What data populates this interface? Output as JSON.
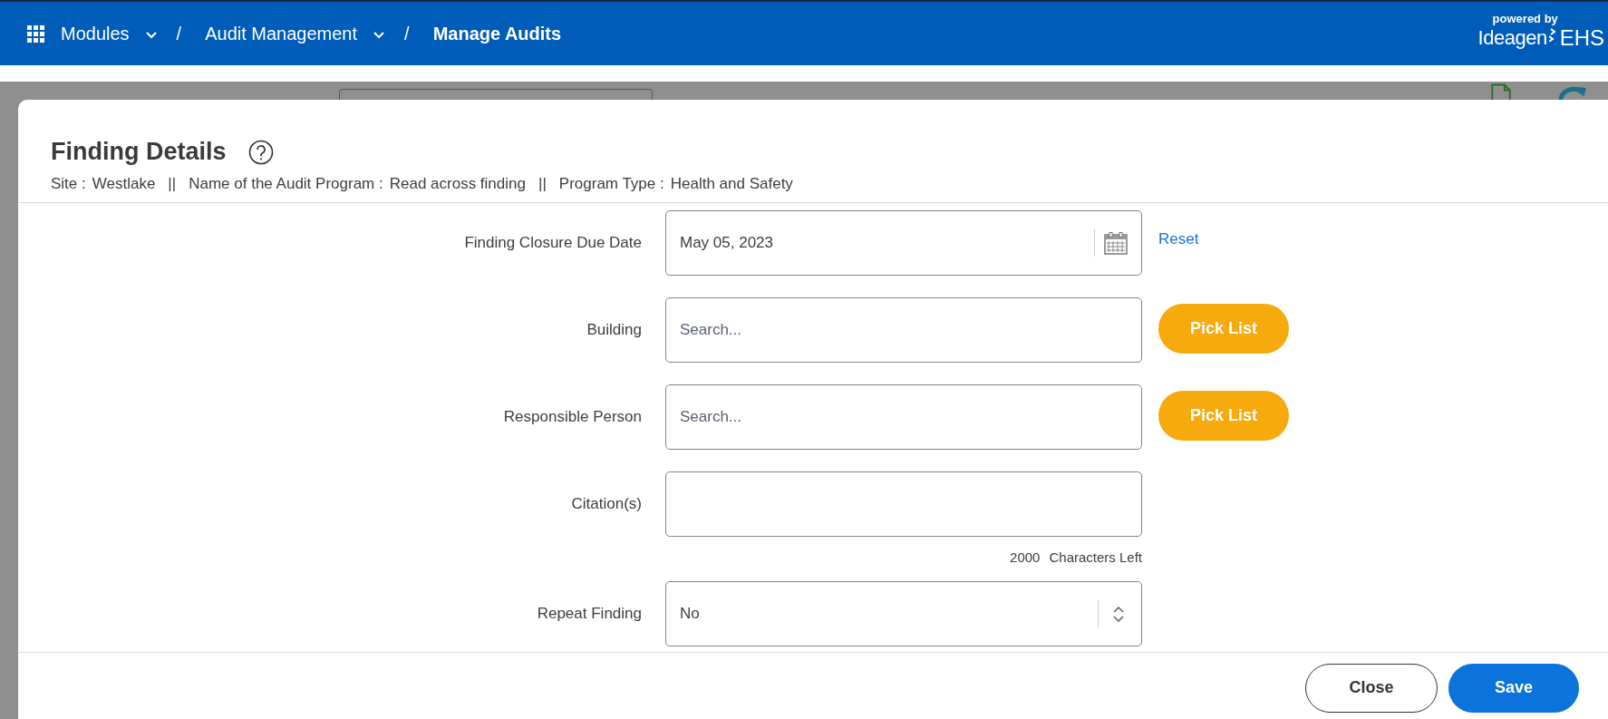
{
  "header": {
    "breadcrumbs": [
      {
        "kind": "menu",
        "label": "Modules"
      },
      {
        "kind": "separator",
        "label": "/"
      },
      {
        "kind": "menu",
        "label": "Audit Management"
      },
      {
        "kind": "separator",
        "label": "/"
      },
      {
        "kind": "current",
        "label": "Manage Audits"
      }
    ],
    "powered_by": "powered by",
    "brand": "Ideagen",
    "product": "EHS"
  },
  "dialog": {
    "title": "Finding Details",
    "meta": [
      {
        "kind": "pair",
        "label": "Site :",
        "value": "Westlake"
      },
      {
        "kind": "separator",
        "label": "||"
      },
      {
        "kind": "pair",
        "label": "Name of the Audit Program :",
        "value": "Read across finding"
      },
      {
        "kind": "separator",
        "label": "||"
      },
      {
        "kind": "pair",
        "label": "Program Type :",
        "value": "Health and Safety"
      }
    ],
    "fields": [
      {
        "kind": "date",
        "label": "Finding Closure Due Date",
        "value": "May 05, 2023",
        "action": "Reset"
      },
      {
        "kind": "search",
        "label": "Building",
        "placeholder": "Search...",
        "action": "Pick List"
      },
      {
        "kind": "search",
        "label": "Responsible Person",
        "placeholder": "Search...",
        "action": "Pick List"
      },
      {
        "kind": "text",
        "label": "Citation(s)",
        "count": "2000",
        "count_label": "Characters Left"
      },
      {
        "kind": "select",
        "label": "Repeat Finding",
        "value": "No"
      }
    ],
    "buttons": [
      {
        "kind": "secondary",
        "label": "Close"
      },
      {
        "kind": "primary",
        "label": "Save"
      }
    ]
  }
}
